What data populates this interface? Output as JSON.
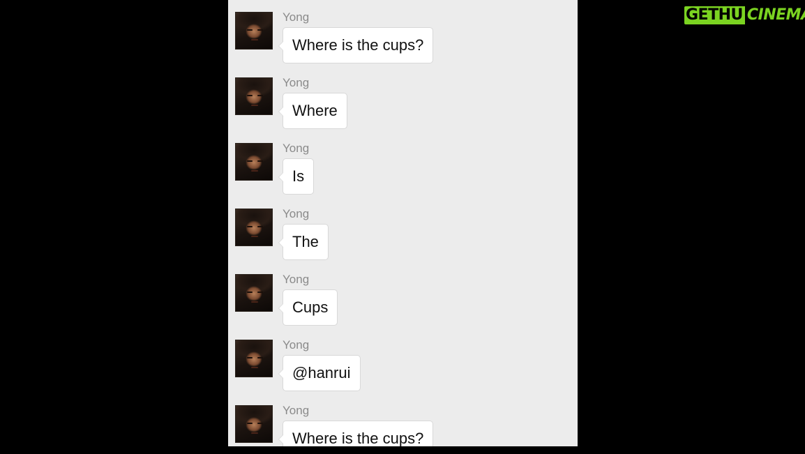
{
  "watermark": {
    "part1": "GETHU",
    "part2": "CINEMA"
  },
  "messages": [
    {
      "sender": "Yong",
      "text": "Where is the cups?"
    },
    {
      "sender": "Yong",
      "text": "Where"
    },
    {
      "sender": "Yong",
      "text": "Is"
    },
    {
      "sender": "Yong",
      "text": "The"
    },
    {
      "sender": "Yong",
      "text": "Cups"
    },
    {
      "sender": "Yong",
      "text": "@hanrui"
    },
    {
      "sender": "Yong",
      "text": "Where is the cups?"
    }
  ],
  "colors": {
    "chat_background": "#ececec",
    "bubble": "#ffffff",
    "sender_name": "#8a8a8a",
    "watermark": "#7bd321"
  }
}
